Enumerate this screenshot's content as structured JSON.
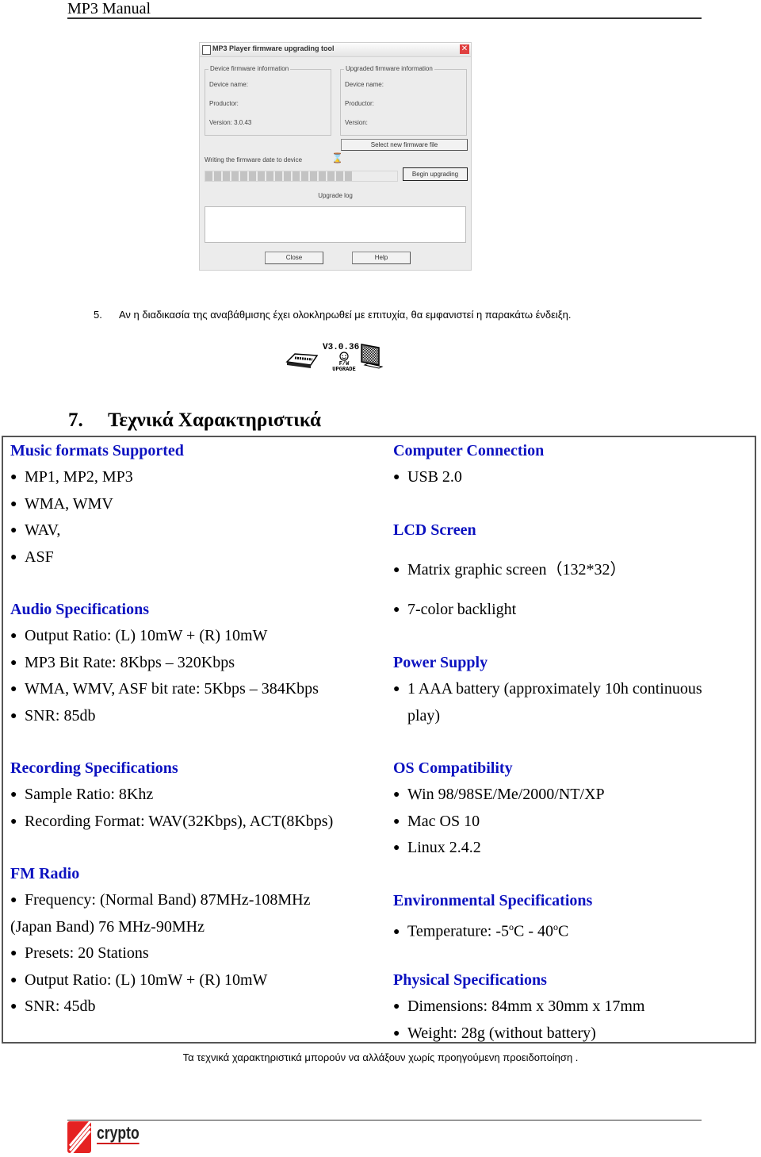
{
  "header": {
    "title": "MP3 Manual"
  },
  "firmware_dialog": {
    "title": "MP3 Player firmware upgrading tool",
    "device_group": {
      "legend": "Device firmware information",
      "device_name_label": "Device name:",
      "productor_label": "Productor:",
      "version_label": "Version: 3.0.43"
    },
    "upgraded_group": {
      "legend": "Upgraded firmware information",
      "device_name_label": "Device name:",
      "productor_label": "Productor:",
      "version_label": "Version:"
    },
    "select_file_button": "Select new firmware file",
    "status_text": "Writing the firmware date to device",
    "progress_percent": 77,
    "begin_button": "Begin upgrading",
    "log_label": "Upgrade log",
    "log_text": "",
    "close_button": "Close",
    "help_button": "Help"
  },
  "step5": {
    "number": "5.",
    "text": "Αν η διαδικασία της αναβάθμισης έχει ολοκληρωθεί με επιτυχία, θα εμφανιστεί η παρακάτω ένδειξη."
  },
  "upgrade_screen": {
    "version": "V3.0.36",
    "line1": "F/W",
    "line2": "UPGRADE"
  },
  "section": {
    "number": "7.",
    "title": "Τεχνικά Χαρακτηριστικά"
  },
  "specs": {
    "music_formats": {
      "heading": "Music formats Supported",
      "items": [
        "MP1, MP2, MP3",
        "WMA, WMV",
        "WAV,",
        "ASF"
      ]
    },
    "audio": {
      "heading": "Audio Specifications",
      "items": [
        "Output Ratio: (L) 10mW + (R) 10mW",
        "MP3 Bit Rate: 8Kbps – 320Kbps",
        "WMA, WMV, ASF bit rate: 5Kbps – 384Kbps",
        "SNR: 85db"
      ]
    },
    "recording": {
      "heading": "Recording Specifications",
      "items": [
        "Sample Ratio: 8Khz",
        "Recording Format: WAV(32Kbps), ACT(8Kbps)"
      ]
    },
    "fm_radio": {
      "heading": "FM Radio",
      "items": [
        "Frequency: (Normal Band) 87MHz-108MHz",
        "(Japan Band) 76 MHz-90MHz",
        "Presets: 20 Stations",
        "Output Ratio: (L) 10mW + (R) 10mW",
        "SNR: 45db"
      ]
    },
    "computer_connection": {
      "heading": "Computer Connection",
      "items": [
        "USB 2.0"
      ]
    },
    "lcd": {
      "heading": "LCD Screen",
      "items": [
        "Matrix graphic screen（132*32）",
        "7-color backlight"
      ]
    },
    "power": {
      "heading": "Power Supply",
      "items": [
        "1 AAA battery (approximately 10h continuous",
        "play)"
      ]
    },
    "os": {
      "heading": "OS Compatibility",
      "items": [
        "Win 98/98SE/Me/2000/NT/XP",
        "Mac OS 10",
        "Linux 2.4.2"
      ]
    },
    "environmental": {
      "heading": "Environmental Specifications",
      "temp_prefix": "Temperature: -5",
      "temp_deg": "o",
      "temp_mid": "C - 40",
      "temp_suffix": "C"
    },
    "physical": {
      "heading": "Physical Specifications",
      "items": [
        "Dimensions: 84mm x 30mm x 17mm",
        "Weight: 28g (without battery)"
      ]
    }
  },
  "note": "Τα τεχνικά χαρακτηριστικά μπορούν να αλλάξουν χωρίς προηγούμενη προειδοποίηση .",
  "footer": {
    "logo_text": "crypto"
  },
  "colors": {
    "heading_blue": "#0c12c0",
    "logo_red": "#e52222"
  }
}
